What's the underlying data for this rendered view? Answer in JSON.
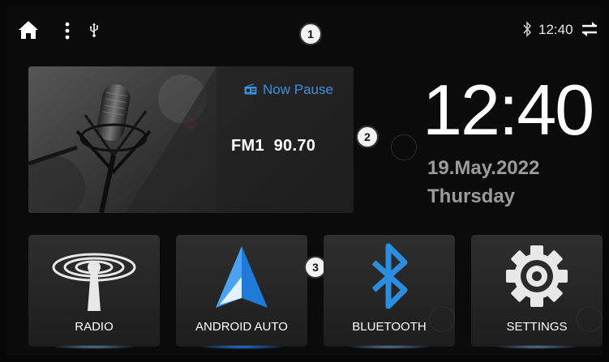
{
  "status_bar": {
    "time": "12:40"
  },
  "callouts": [
    "1",
    "2",
    "3"
  ],
  "radio_card": {
    "status": "Now Pause",
    "station": "FM1  90.70"
  },
  "clock": {
    "time": "12:40",
    "date": "19.May.2022",
    "day": "Thursday"
  },
  "apps": [
    {
      "label": "RADIO",
      "icon": "radio-antenna-icon"
    },
    {
      "label": "ANDROID AUTO",
      "icon": "android-auto-icon"
    },
    {
      "label": "BLUETOOTH",
      "icon": "bluetooth-icon"
    },
    {
      "label": "SETTINGS",
      "icon": "gear-icon"
    }
  ],
  "colors": {
    "accent_blue": "#3d8fe0",
    "background": "#0b0b0b",
    "tile": "#2a2a2a",
    "muted_text": "#9b9b9b"
  }
}
